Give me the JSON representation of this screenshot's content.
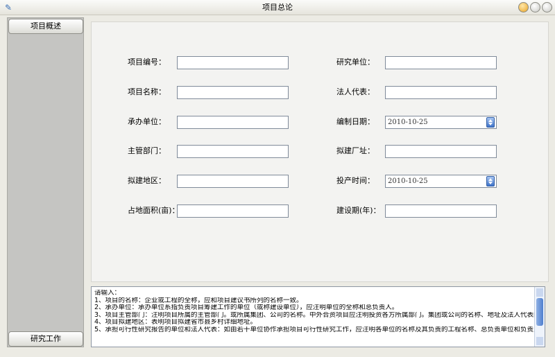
{
  "window": {
    "title": "项目总论"
  },
  "sidebar": {
    "top_button": "项目概述",
    "bottom_button": "研究工作"
  },
  "form": {
    "left": [
      {
        "label": "项目编号：",
        "value": ""
      },
      {
        "label": "项目名称：",
        "value": ""
      },
      {
        "label": "承办单位：",
        "value": ""
      },
      {
        "label": "主管部门：",
        "value": ""
      },
      {
        "label": "拟建地区：",
        "value": ""
      },
      {
        "label": "占地面积(亩)：",
        "value": ""
      }
    ],
    "right": [
      {
        "label": "研究单位：",
        "value": ""
      },
      {
        "label": "法人代表：",
        "value": ""
      },
      {
        "label": "编制日期：",
        "value": "2010-10-25"
      },
      {
        "label": "拟建厂址：",
        "value": ""
      },
      {
        "label": "投产时间：",
        "value": "2010-10-25"
      },
      {
        "label": "建设期(年)：",
        "value": ""
      }
    ]
  },
  "help": {
    "lines": [
      "请输入：",
      "1、项目的名称：企业或工程的全称，应和项目建议书所列的名称一致。",
      "2、承办单位：承办单位系指负责项目筹建工作的单位（或称建设单位），应注明单位的全称和总负责人。",
      "3、项目主管部门：注明项目所属的主管部门。或所属集团、公司的名称。中外合资项目应注明投资各方所属部门。集团或公司的名称、地址及法人代表的姓名、国籍。",
      "4、项目拟建地区：表明项目拟建省市县乡村详细地址。",
      "5、承担可行性研究报告的单位和法人代表：如由若干单位协作承担项目可行性研究工作，应注明各单位的名称及其负责的工程名称、总负责单位和负责人。"
    ]
  }
}
